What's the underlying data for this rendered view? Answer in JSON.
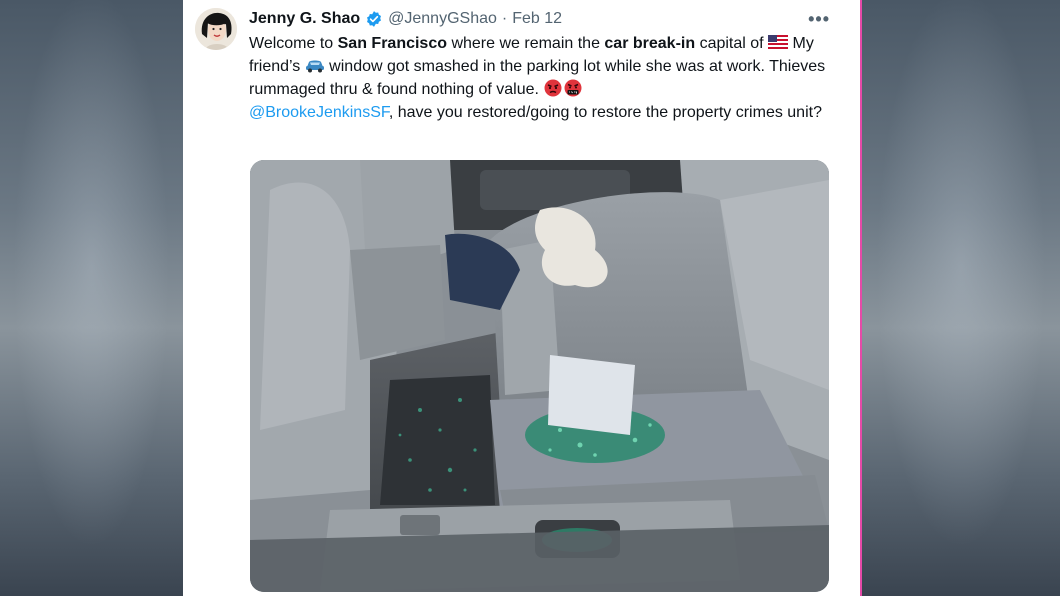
{
  "tweet": {
    "author_name": "Jenny G. Shao",
    "handle": "@JennyGShao",
    "separator": "·",
    "date": "Feb 12",
    "more_icon": "more-horizontal-icon",
    "verified_icon": "verified-badge-icon",
    "text": {
      "p1": "Welcome to ",
      "b1": "San Francisco",
      "p2": " where we remain the ",
      "b2": "car break-in",
      "p3": " capital of ",
      "p4": " My friend’s ",
      "p5": " window got smashed in the parking lot while she was at work. Thieves rummaged thru & found nothing of value. ",
      "mention": "@BrookeJenkinsSF",
      "p6": ", have you restored/going to restore the property crimes unit?"
    },
    "emojis": [
      "us-flag-emoji",
      "car-emoji",
      "angry-face-emoji",
      "cursing-face-emoji"
    ]
  },
  "colors": {
    "text": "#0f1419",
    "secondary": "#536471",
    "link": "#1d9bf0",
    "verified": "#1d9bf0",
    "frame_accent": "#e64aa8"
  }
}
